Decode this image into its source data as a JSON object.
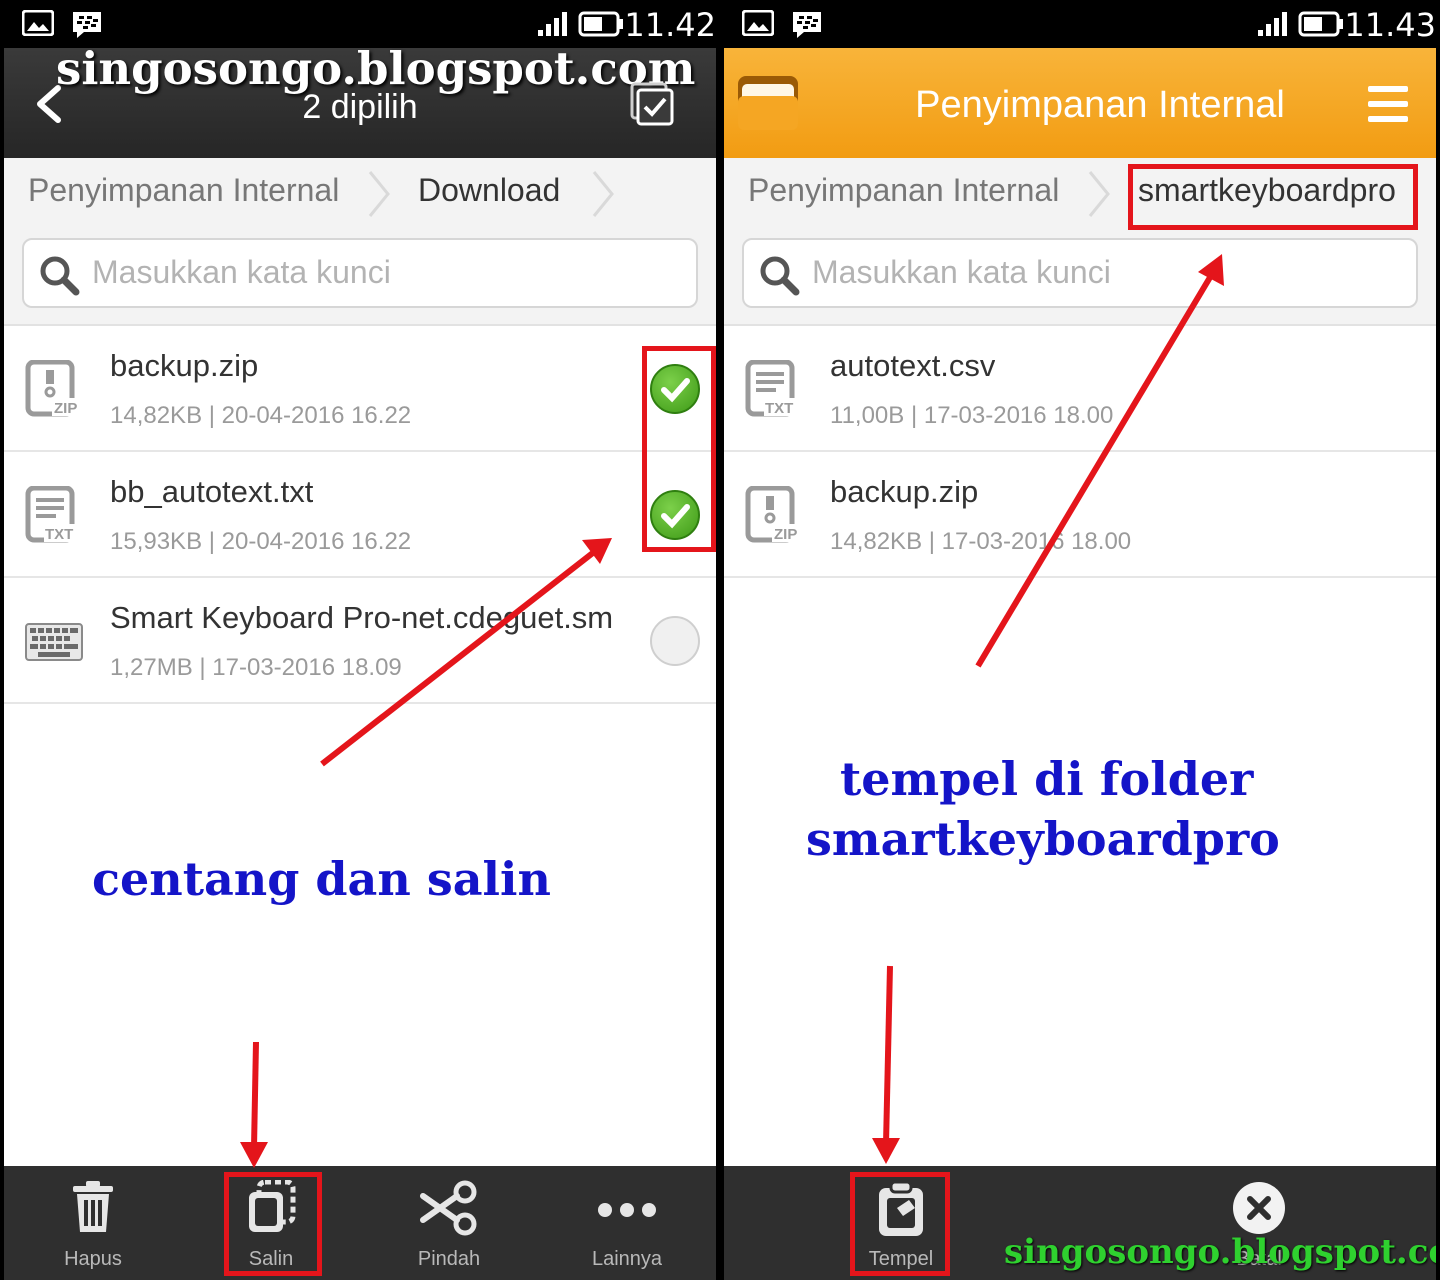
{
  "left": {
    "status": {
      "time": "11.42"
    },
    "header": {
      "title": "2 dipilih",
      "watermark": "singosongo.blogspot.com"
    },
    "breadcrumb": [
      "Penyimpanan Internal",
      "Download"
    ],
    "search": {
      "placeholder": "Masukkan kata kunci"
    },
    "files": [
      {
        "name": "backup.zip",
        "meta": "14,82KB | 20-04-2016 16.22",
        "icon": "zip-file-icon",
        "checked": true
      },
      {
        "name": "bb_autotext.txt",
        "meta": "15,93KB | 20-04-2016 16.22",
        "icon": "txt-file-icon",
        "checked": true
      },
      {
        "name": "Smart Keyboard Pro-net.cdeguet.sm",
        "meta": "1,27MB | 17-03-2016 18.09",
        "icon": "keyboard-app-icon",
        "checked": false
      }
    ],
    "toolbar": {
      "delete": "Hapus",
      "copy": "Salin",
      "move": "Pindah",
      "more": "Lainnya"
    },
    "annotation": "centang dan salin"
  },
  "right": {
    "status": {
      "time": "11.43"
    },
    "header": {
      "title": "Penyimpanan Internal"
    },
    "breadcrumb": [
      "Penyimpanan Internal",
      "smartkeyboardpro"
    ],
    "search": {
      "placeholder": "Masukkan kata kunci"
    },
    "files": [
      {
        "name": "autotext.csv",
        "meta": "11,00B | 17-03-2016 18.00",
        "icon": "txt-file-icon"
      },
      {
        "name": "backup.zip",
        "meta": "14,82KB | 17-03-2016 18.00",
        "icon": "zip-file-icon"
      }
    ],
    "toolbar": {
      "paste": "Tempel",
      "cancel": "Batal"
    },
    "annotation_line1": "tempel di folder",
    "annotation_line2": "smartkeyboardpro",
    "watermark": "singosongo.blogspot.com"
  },
  "colors": {
    "accent_orange": "#f29c12",
    "check_green": "#3e9a17",
    "annotation_blue": "#1414c8",
    "highlight_red": "#e4151b",
    "watermark_green": "#2fd12f"
  }
}
